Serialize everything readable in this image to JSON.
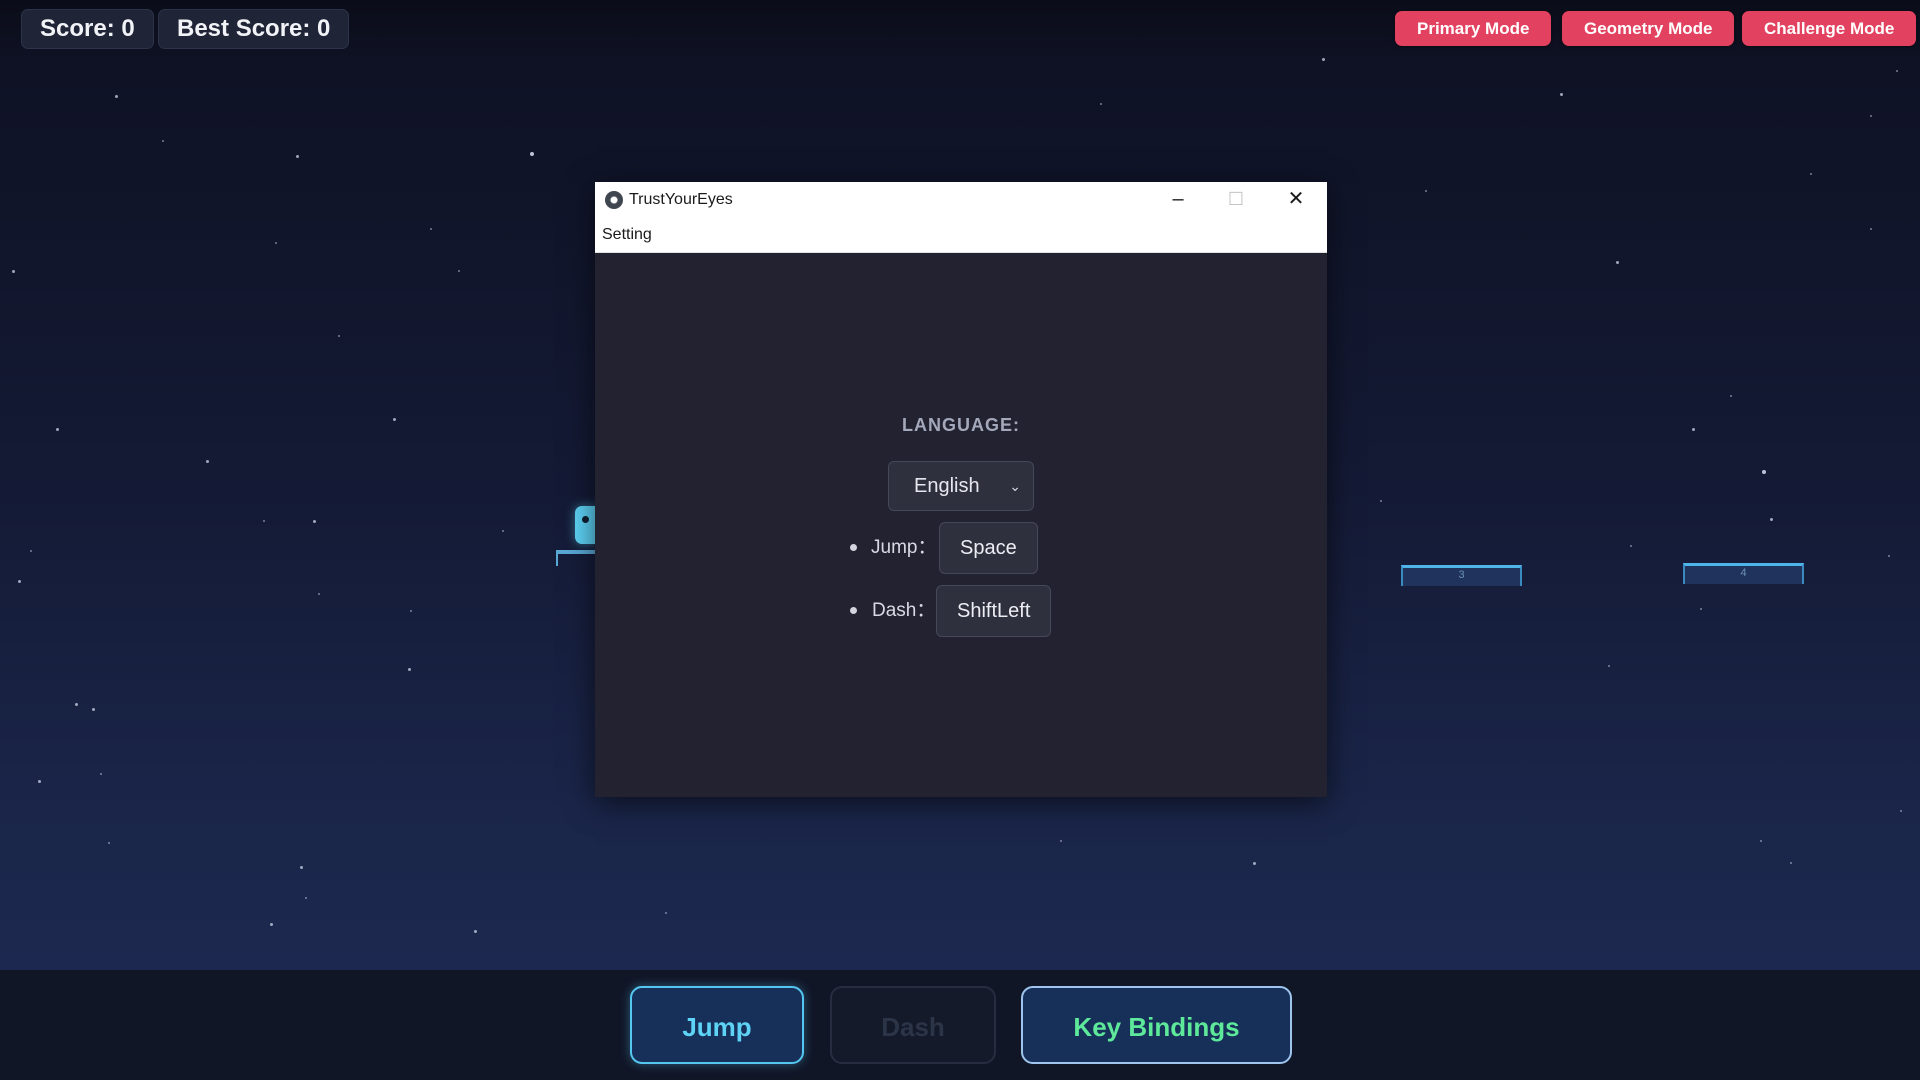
{
  "hud": {
    "score": "Score: 0",
    "best_score": "Best Score: 0"
  },
  "modes": {
    "primary": "Primary Mode",
    "geometry": "Geometry Mode",
    "challenge": "Challenge Mode"
  },
  "game": {
    "platforms": [
      "3",
      "4"
    ]
  },
  "controls": {
    "jump": "Jump",
    "dash": "Dash",
    "key_bindings": "Key Bindings"
  },
  "window": {
    "title": "TrustYourEyes",
    "menu": "Setting",
    "minimize_glyph": "–",
    "maximize_glyph": "☐",
    "close_glyph": "✕"
  },
  "settings": {
    "language_label": "LANGUAGE:",
    "language_value": "English",
    "chevron_glyph": "⌄",
    "bindings": [
      {
        "label": "Jump：",
        "key": "Space"
      },
      {
        "label": "Dash：",
        "key": "ShiftLeft"
      }
    ]
  },
  "colors": {
    "mode_button": "#e2415f",
    "player": "#5ed3f6",
    "key_bindings_text": "#5ee89a"
  }
}
